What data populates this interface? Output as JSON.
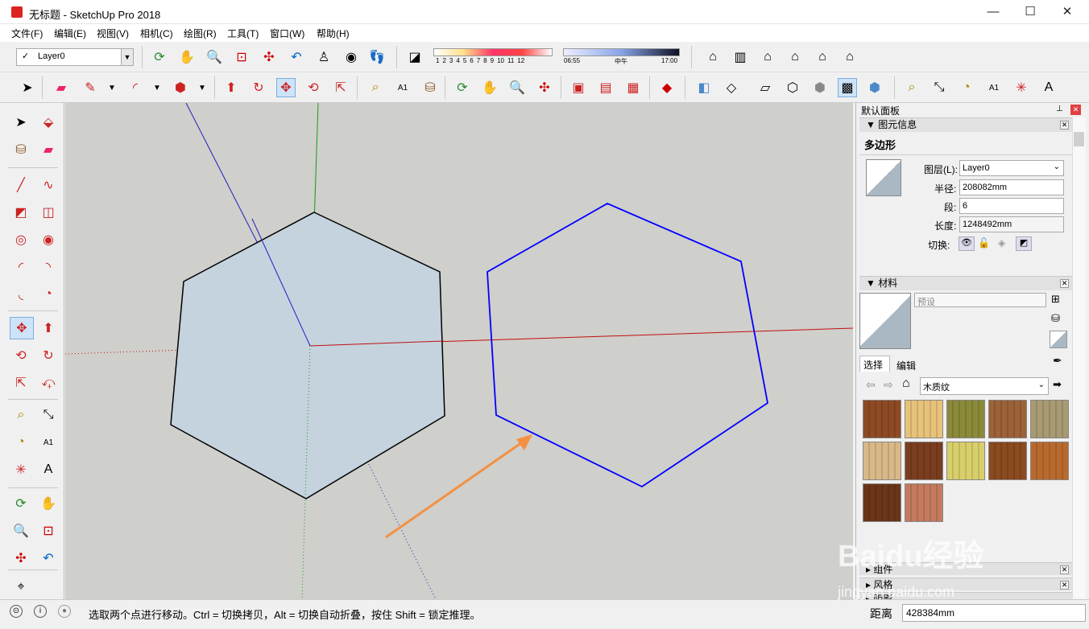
{
  "window": {
    "title": "无标题 - SketchUp Pro 2018",
    "min": "—",
    "max": "☐",
    "close": "✕"
  },
  "menu": [
    "文件(F)",
    "编辑(E)",
    "视图(V)",
    "相机(C)",
    "绘图(R)",
    "工具(T)",
    "窗口(W)",
    "帮助(H)"
  ],
  "layer_toolbar": {
    "current_layer": "Layer0"
  },
  "shadow_toolbar": {
    "month_ticks": [
      "1",
      "2",
      "3",
      "4",
      "5",
      "6",
      "7",
      "8",
      "9",
      "10",
      "11",
      "12"
    ],
    "time_start": "06:55",
    "time_mid": "中午",
    "time_end": "17:00"
  },
  "default_tray": {
    "title": "默认面板",
    "entity_info": {
      "header": "图元信息",
      "entity_type": "多边形",
      "layer_label": "图层(L):",
      "layer_value": "Layer0",
      "radius_label": "半径:",
      "radius_value": "208082mm",
      "segments_label": "段:",
      "segments_value": "6",
      "length_label": "长度:",
      "length_value": "1248492mm",
      "toggles_label": "切换:"
    },
    "materials": {
      "header": "材料",
      "name_placeholder": "预设",
      "tab_select": "选择",
      "tab_edit": "编辑",
      "library": "木质纹",
      "swatch_colors": [
        "#8e4a24",
        "#e7c27a",
        "#8a8a3a",
        "#9c6238",
        "#a89a72",
        "#d9b887",
        "#7a3d1f",
        "#d9cf6a",
        "#8b4a20",
        "#b86a2e",
        "#6a3518",
        "#c47a5e"
      ]
    },
    "collapsed_headers": [
      "组件",
      "风格",
      "阴影"
    ]
  },
  "status": {
    "message": "选取两个点进行移动。Ctrl = 切换拷贝，Alt = 切换自动折叠，按住 Shift = 锁定推理。",
    "measure_label": "距离",
    "measure_value": "428384mm"
  },
  "watermark": {
    "logo": "Baidu经验",
    "url": "jingyan.baidu.com"
  },
  "colors": {
    "selected_edge": "#0000ff",
    "face": "#c4d3de",
    "viewport_bg": "#cfcfcb",
    "arrow": "#f39041"
  }
}
